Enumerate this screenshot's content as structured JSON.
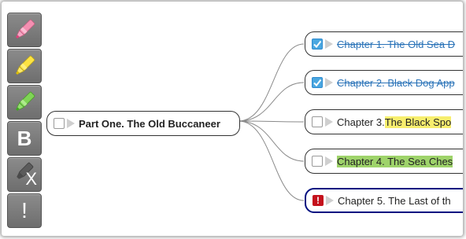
{
  "toolbar": {
    "buttons": [
      {
        "name": "pink-marker",
        "color": "#f48fb1"
      },
      {
        "name": "yellow-marker",
        "color": "#fde342"
      },
      {
        "name": "green-marker",
        "color": "#7fd455"
      },
      {
        "name": "bold",
        "label": "B"
      },
      {
        "name": "clear-format",
        "label": "X"
      },
      {
        "name": "important",
        "label": "!"
      }
    ]
  },
  "root": {
    "label": "Part One. The Old Buccaneer"
  },
  "chapters": [
    {
      "prefix": "",
      "label": "Chapter 1. The Old Sea D",
      "rest": "",
      "checked": true,
      "status": "done"
    },
    {
      "prefix": "",
      "label": "Chapter 2. Black Dog App",
      "rest": "",
      "checked": true,
      "status": "done"
    },
    {
      "prefix": "Chapter 3. ",
      "label": "The Black Spo",
      "rest": "",
      "checked": false,
      "highlight": "#f7ee6e"
    },
    {
      "prefix": "",
      "label": "Chapter 4. The Sea Ches",
      "rest": "",
      "checked": false,
      "highlight": "#9ed36a"
    },
    {
      "prefix": "",
      "label": "Chapter 5. The Last of th",
      "rest": "",
      "checked": false,
      "flag": "!"
    }
  ],
  "colors": {
    "done_text": "#2a73b8",
    "selection_border": "#000e80",
    "alert": "#c4101c"
  }
}
